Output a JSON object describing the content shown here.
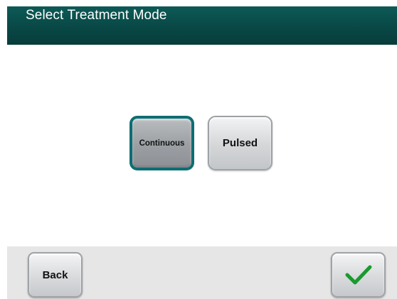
{
  "header": {
    "title": "Select Treatment Mode"
  },
  "mode_options": {
    "continuous_label": "Continuous",
    "pulsed_label": "Pulsed",
    "selected": "Continuous"
  },
  "footer": {
    "back_label": "Back",
    "confirm_icon": "checkmark-icon"
  },
  "colors": {
    "header_bg": "#094845",
    "selected_border": "#0d6e73",
    "checkmark": "#1a9a2e",
    "footer_bg": "#e6e6e6"
  }
}
